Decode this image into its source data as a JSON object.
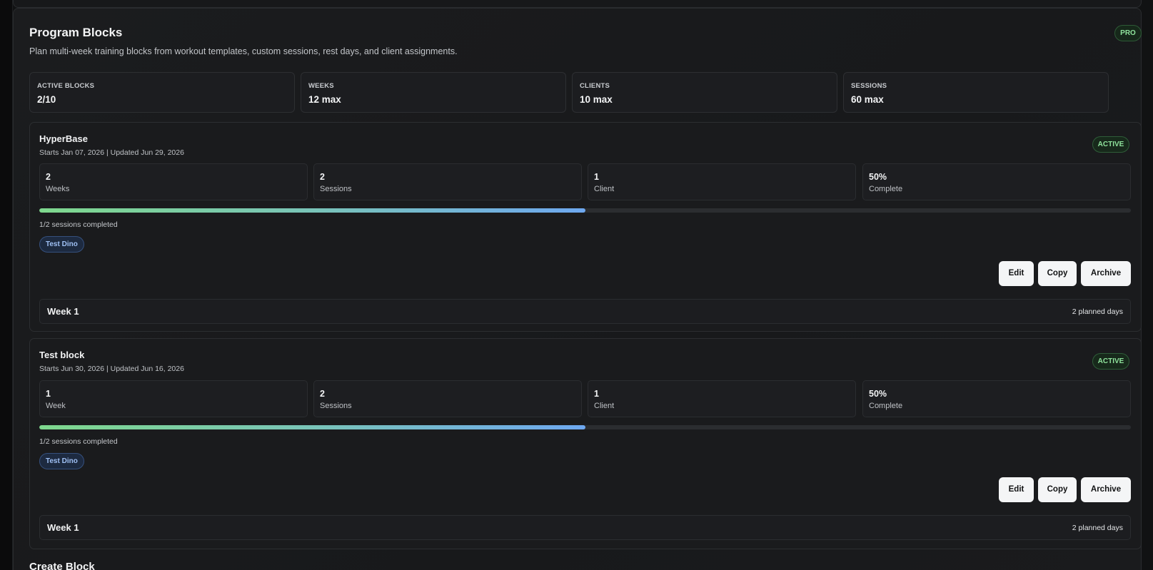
{
  "header": {
    "title": "Program Blocks",
    "subtitle": "Plan multi-week training blocks from workout templates, custom sessions, rest days, and client assignments.",
    "badge": "PRO"
  },
  "stats": [
    {
      "label": "ACTIVE BLOCKS",
      "value": "2/10"
    },
    {
      "label": "WEEKS",
      "value": "12 max"
    },
    {
      "label": "CLIENTS",
      "value": "10 max"
    },
    {
      "label": "SESSIONS",
      "value": "60 max"
    }
  ],
  "blocks": [
    {
      "name": "HyperBase",
      "meta": "Starts Jan 07, 2026 | Updated Jun 29, 2026",
      "status": "ACTIVE",
      "metrics": [
        {
          "value": "2",
          "label": "Weeks"
        },
        {
          "value": "2",
          "label": "Sessions"
        },
        {
          "value": "1",
          "label": "Client"
        },
        {
          "value": "50%",
          "label": "Complete"
        }
      ],
      "progress": 0.5,
      "progress_text": "1/2 sessions completed",
      "client": "Test Dino",
      "actions": {
        "edit": "Edit",
        "copy": "Copy",
        "archive": "Archive"
      },
      "week": {
        "title": "Week 1",
        "days": "2 planned days"
      }
    },
    {
      "name": "Test block",
      "meta": "Starts Jun 30, 2026 | Updated Jun 16, 2026",
      "status": "ACTIVE",
      "metrics": [
        {
          "value": "1",
          "label": "Week"
        },
        {
          "value": "2",
          "label": "Sessions"
        },
        {
          "value": "1",
          "label": "Client"
        },
        {
          "value": "50%",
          "label": "Complete"
        }
      ],
      "progress": 0.5,
      "progress_text": "1/2 sessions completed",
      "client": "Test Dino",
      "actions": {
        "edit": "Edit",
        "copy": "Copy",
        "archive": "Archive"
      },
      "week": {
        "title": "Week 1",
        "days": "2 planned days"
      }
    }
  ],
  "create_section": {
    "title": "Create Block"
  },
  "colors": {
    "accent_green": "#8fe39c",
    "accent_blue": "#6ea8f0",
    "background": "#1a1b1d"
  }
}
